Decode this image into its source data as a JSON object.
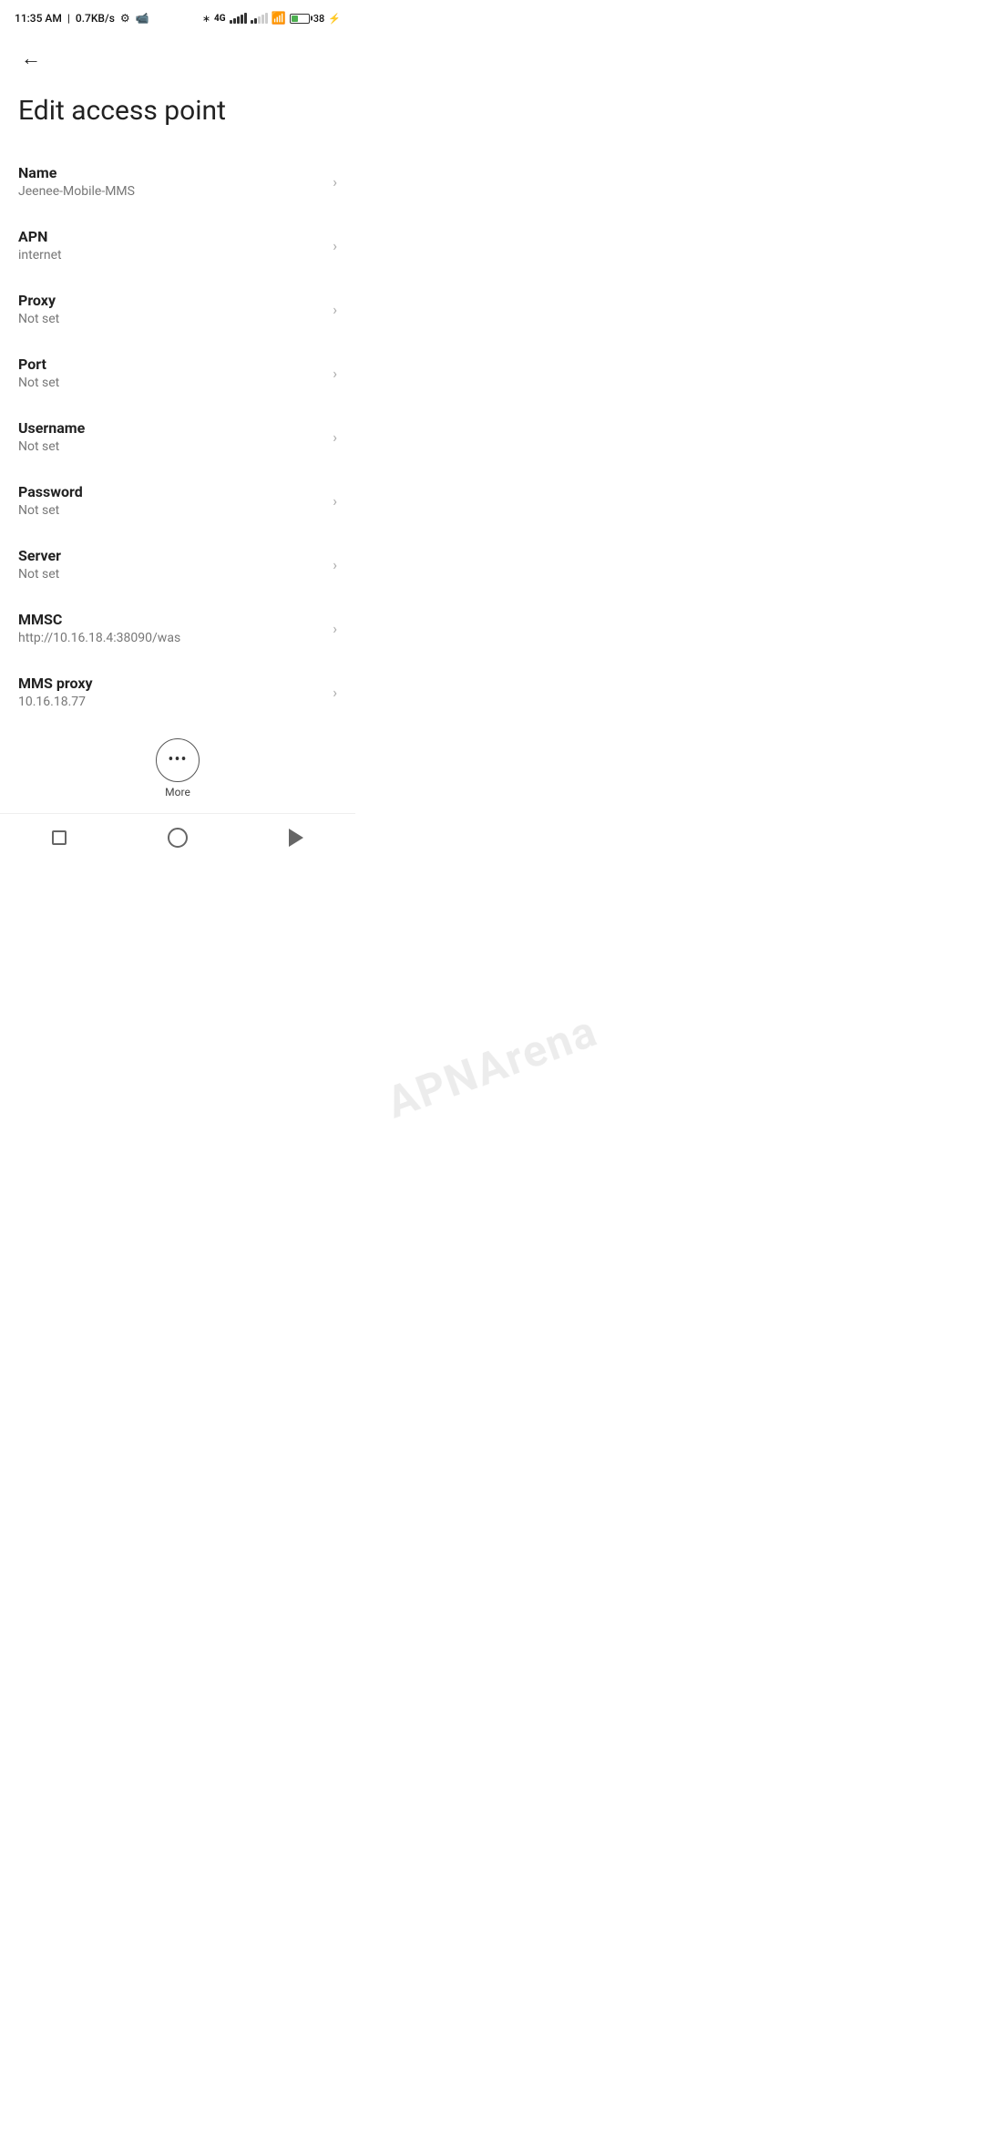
{
  "statusBar": {
    "time": "11:35 AM",
    "speed": "0.7KB/s",
    "batteryPercent": "38"
  },
  "nav": {
    "backLabel": "←"
  },
  "page": {
    "title": "Edit access point"
  },
  "settings": [
    {
      "label": "Name",
      "value": "Jeenee-Mobile-MMS"
    },
    {
      "label": "APN",
      "value": "internet"
    },
    {
      "label": "Proxy",
      "value": "Not set"
    },
    {
      "label": "Port",
      "value": "Not set"
    },
    {
      "label": "Username",
      "value": "Not set"
    },
    {
      "label": "Password",
      "value": "Not set"
    },
    {
      "label": "Server",
      "value": "Not set"
    },
    {
      "label": "MMSC",
      "value": "http://10.16.18.4:38090/was"
    },
    {
      "label": "MMS proxy",
      "value": "10.16.18.77"
    }
  ],
  "watermark": "APNArena",
  "more": {
    "label": "More"
  },
  "bottomNav": {
    "square": "recent-apps",
    "circle": "home",
    "triangle": "back"
  }
}
